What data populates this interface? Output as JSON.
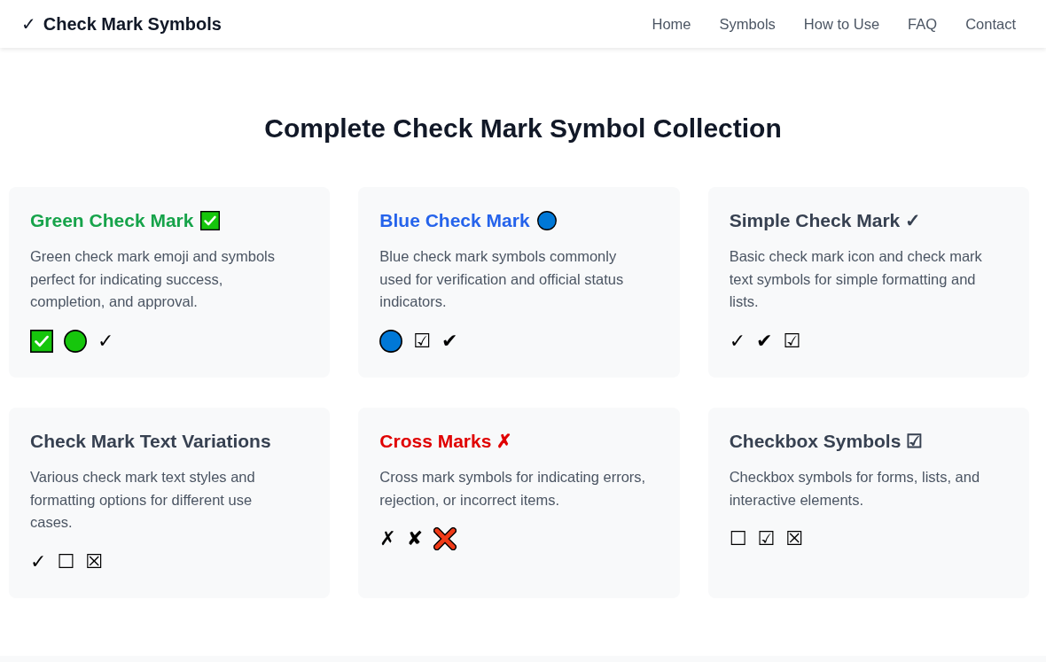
{
  "header": {
    "logo_symbol": "✓",
    "site_title": "Check Mark Symbols",
    "nav": [
      "Home",
      "Symbols",
      "How to Use",
      "FAQ",
      "Contact"
    ]
  },
  "heading": "Complete Check Mark Symbol Collection",
  "cards": [
    {
      "title": "Green Check Mark",
      "color": "#16a34a",
      "title_symbol": {
        "kind": "checkbox",
        "color": "#16c60c"
      },
      "description": "Green check mark emoji and symbols perfect for indicating success, completion, and approval.",
      "symbols": [
        {
          "kind": "checkbox",
          "color": "#16c60c"
        },
        {
          "kind": "circle",
          "color": "#16c60c"
        },
        {
          "kind": "glyph",
          "text": "✓"
        }
      ]
    },
    {
      "title": "Blue Check Mark",
      "color": "#2563eb",
      "title_symbol": {
        "kind": "circle",
        "color": "#0078d7"
      },
      "description": "Blue check mark symbols commonly used for verification and official status indicators.",
      "symbols": [
        {
          "kind": "circle",
          "color": "#0078d7"
        },
        {
          "kind": "glyph",
          "text": "☑"
        },
        {
          "kind": "glyph",
          "text": "✔"
        }
      ]
    },
    {
      "title": "Simple Check Mark ✓",
      "color": "#374151",
      "description": "Basic check mark icon and check mark text symbols for simple formatting and lists.",
      "symbols": [
        {
          "kind": "glyph",
          "text": "✓"
        },
        {
          "kind": "glyph",
          "text": "✔"
        },
        {
          "kind": "glyph",
          "text": "☑"
        }
      ]
    },
    {
      "title": "Check Mark Text Variations",
      "color": "#374151",
      "description": "Various check mark text styles and formatting options for different use cases.",
      "symbols": [
        {
          "kind": "glyph",
          "text": "✓"
        },
        {
          "kind": "glyph",
          "text": "☐"
        },
        {
          "kind": "glyph",
          "text": "☒"
        }
      ]
    },
    {
      "title": "Cross Marks ✗",
      "color": "#e00000",
      "description": "Cross mark symbols for indicating errors, rejection, or incorrect items.",
      "symbols": [
        {
          "kind": "glyph",
          "text": "✗"
        },
        {
          "kind": "glyph",
          "text": "✘"
        },
        {
          "kind": "cross",
          "color": "#f03a17"
        }
      ]
    },
    {
      "title": "Checkbox Symbols ☑",
      "color": "#374151",
      "description": "Checkbox symbols for forms, lists, and interactive elements.",
      "symbols": [
        {
          "kind": "glyph",
          "text": "☐"
        },
        {
          "kind": "glyph",
          "text": "☑"
        },
        {
          "kind": "glyph",
          "text": "☒"
        }
      ]
    }
  ]
}
